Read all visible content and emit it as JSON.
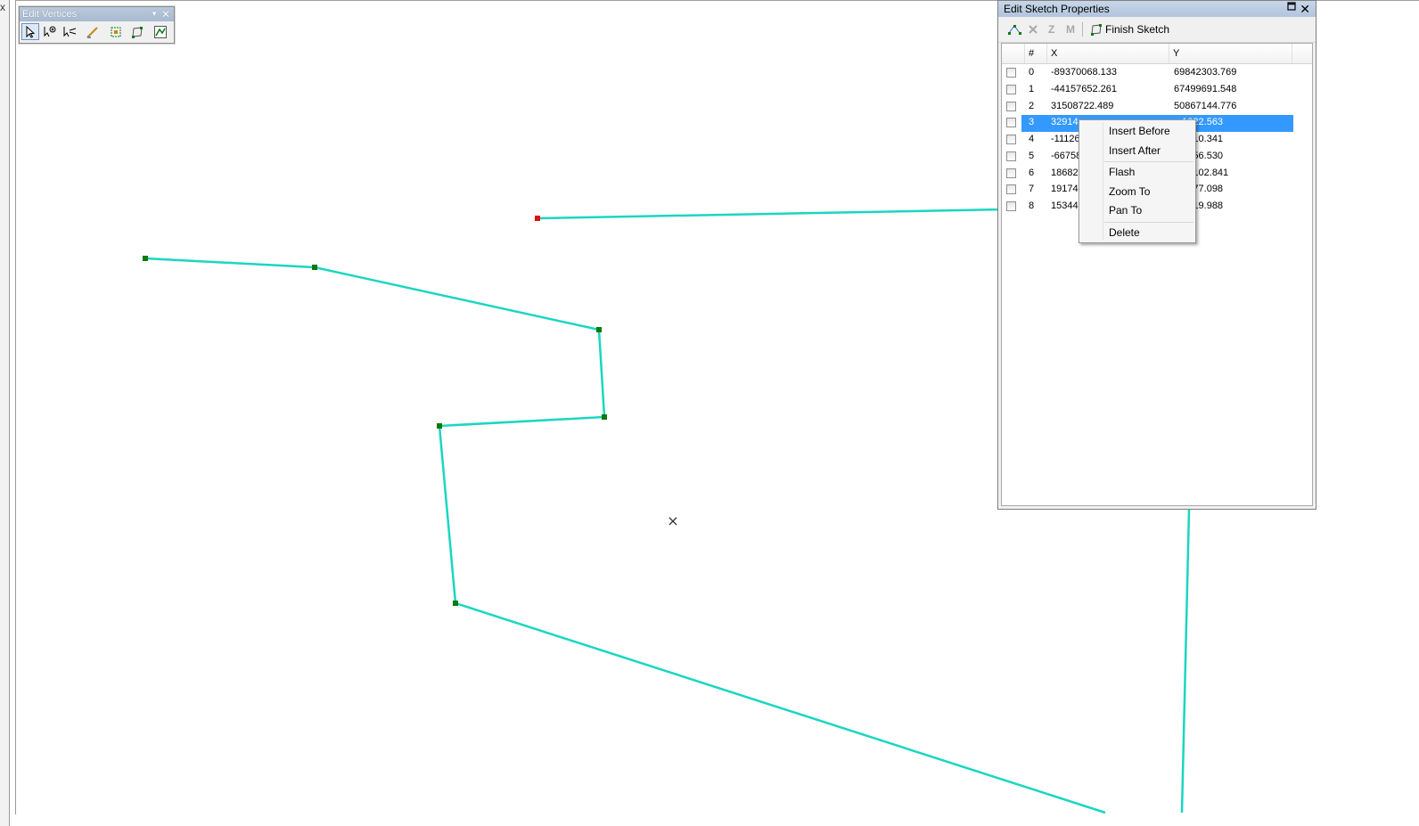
{
  "left_gutter": {
    "close_glyph": "x"
  },
  "edit_vertices_toolbar": {
    "title": "Edit Vertices",
    "dropdown_glyph": "▼",
    "close_glyph": "✕",
    "tools": [
      {
        "icon": "modify-sketch-vertices-icon"
      },
      {
        "icon": "add-vertex-icon"
      },
      {
        "icon": "delete-vertex-icon"
      },
      {
        "icon": "continue-feature-icon"
      },
      {
        "icon": "reshape-edge-icon"
      },
      {
        "icon": "sketch-properties-icon"
      },
      {
        "icon": "generalize-icon"
      }
    ]
  },
  "edit_sketch_properties": {
    "title": "Edit Sketch Properties",
    "close_glyph": "✕",
    "toolbar": {
      "z_label": "Z",
      "m_label": "M",
      "finish_sketch_label": "Finish Sketch"
    },
    "columns": {
      "index": "#",
      "x": "X",
      "y": "Y"
    },
    "rows": [
      {
        "index": "0",
        "x": "-89370068.133",
        "y": "69842303.769"
      },
      {
        "index": "1",
        "x": "-44157652.261",
        "y": "67499691.548"
      },
      {
        "index": "2",
        "x": "31508722.489",
        "y": "50867144.776"
      },
      {
        "index": "3",
        "x": "32914",
        "y": "...1022.563"
      },
      {
        "index": "4",
        "x": "-11126",
        "y": "...3410.341"
      },
      {
        "index": "5",
        "x": "-66758",
        "y": "...2356.530"
      },
      {
        "index": "6",
        "x": "186823",
        "y": "...70102.841"
      },
      {
        "index": "7",
        "x": "191743",
        "y": "...7977.098"
      },
      {
        "index": "8",
        "x": "153446",
        "y": "...3319.988"
      }
    ],
    "selected_row": 3
  },
  "context_menu": {
    "insert_before": "Insert Before",
    "insert_after": "Insert After",
    "flash": "Flash",
    "zoom_to": "Zoom To",
    "pan_to": "Pan To",
    "delete": "Delete"
  },
  "map": {
    "line_color": "#19d6c2",
    "vertex_color": "#0a7a10",
    "selected_vertex_color": "#e01010",
    "cursor_glyph": "×"
  }
}
